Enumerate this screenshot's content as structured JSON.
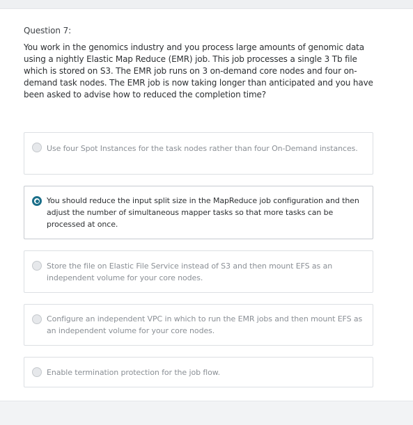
{
  "question": {
    "label": "Question 7:",
    "text": "You work in the genomics industry and you process large amounts of genomic data using a nightly Elastic Map Reduce (EMR) job. This job processes a single 3 Tb file which is stored on S3. The EMR job runs on 3 on-demand core nodes and four on-demand task nodes. The EMR job is now taking longer than anticipated and you have been asked to advise how to reduced the completion time?"
  },
  "options": [
    {
      "text": "Use four Spot Instances for the task nodes rather than four On-Demand instances.",
      "selected": false
    },
    {
      "text": "You should reduce the input split size in the MapReduce job configuration and then adjust the number of simultaneous mapper tasks so that more tasks can be processed at once.",
      "selected": true
    },
    {
      "text": "Store the file on Elastic File Service instead of S3 and then mount EFS as an independent volume for your core nodes.",
      "selected": false
    },
    {
      "text": "Configure an independent VPC in which to run the EMR jobs and then mount EFS as an independent volume for your core nodes.",
      "selected": false
    },
    {
      "text": "Enable termination protection for the job flow.",
      "selected": false
    }
  ],
  "colors": {
    "accent": "#1b6f8a",
    "muted_text": "#8a8f95",
    "text": "#2d3033"
  }
}
